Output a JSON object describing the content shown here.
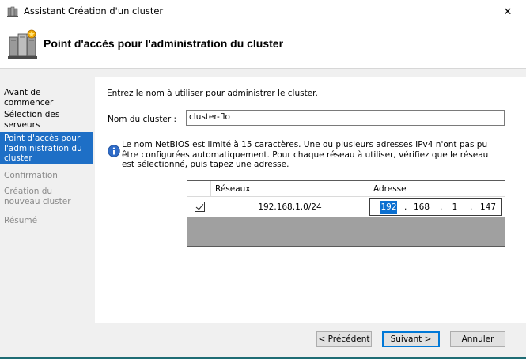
{
  "window": {
    "title": "Assistant Création d'un cluster",
    "close_glyph": "✕"
  },
  "header": {
    "title": "Point d'accès pour l'administration du cluster"
  },
  "sidebar": {
    "steps": [
      {
        "label": "Avant de commencer",
        "state": "normal"
      },
      {
        "label": "Sélection des serveurs",
        "state": "normal"
      },
      {
        "label": "Point d'accès pour l'administration du cluster",
        "state": "active"
      },
      {
        "label": "Confirmation",
        "state": "disabled"
      },
      {
        "label": "Création du nouveau cluster",
        "state": "disabled"
      },
      {
        "label": "Résumé",
        "state": "disabled"
      }
    ]
  },
  "main": {
    "intro": "Entrez le nom à utiliser pour administrer le cluster.",
    "cluster_name_label": "Nom du cluster :",
    "cluster_name_value": "cluster-flo",
    "info_text": "Le nom NetBIOS est limité à 15 caractères.  Une ou plusieurs adresses IPv4 n'ont pas pu être configurées automatiquement. Pour chaque réseau à utiliser, vérifiez que le réseau est sélectionné, puis tapez une adresse.",
    "grid": {
      "col_networks": "Réseaux",
      "col_address": "Adresse",
      "rows": [
        {
          "checked": true,
          "network": "192.168.1.0/24",
          "octets": [
            "192",
            "168",
            "1",
            "147"
          ]
        }
      ]
    }
  },
  "buttons": {
    "previous": "< Précédent",
    "next": "Suivant >",
    "cancel": "Annuler"
  },
  "colors": {
    "active_step": "#1e6fc6",
    "selection": "#0b6fd0",
    "bottom_accent": "#1f6c74"
  },
  "icons": {
    "app": "cluster-icon",
    "header": "server-cluster-icon",
    "info": "info-icon"
  }
}
